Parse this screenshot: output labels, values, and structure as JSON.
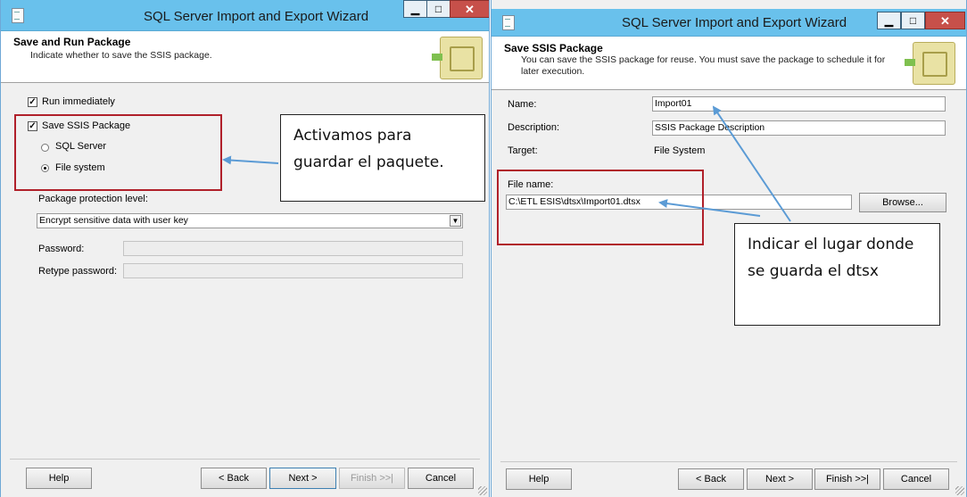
{
  "window1": {
    "title": "SQL Server Import and Export Wizard",
    "header_title": "Save and Run Package",
    "header_subtitle": "Indicate whether to save the SSIS package.",
    "run_immediately": {
      "label": "Run immediately",
      "checked": true
    },
    "save_ssis": {
      "label": "Save SSIS Package",
      "checked": true
    },
    "sql_server": {
      "label": "SQL Server",
      "selected": false
    },
    "file_system": {
      "label": "File system",
      "selected": true
    },
    "protection_label": "Package protection level:",
    "protection_value": "Encrypt sensitive data with user key",
    "password_label": "Password:",
    "retype_label": "Retype password:",
    "buttons": {
      "help": "Help",
      "back": "< Back",
      "next": "Next >",
      "finish": "Finish >>|",
      "cancel": "Cancel"
    }
  },
  "window2": {
    "title": "SQL Server Import and Export Wizard",
    "header_title": "Save SSIS Package",
    "header_subtitle": "You can save the SSIS package for reuse. You must save the package to schedule it for later execution.",
    "name_label": "Name:",
    "name_value": "Import01",
    "description_label": "Description:",
    "description_value": "SSIS Package Description",
    "target_label": "Target:",
    "target_value": "File System",
    "filename_label": "File name:",
    "filename_value": "C:\\ETL ESIS\\dtsx\\Import01.dtsx",
    "browse": "Browse...",
    "buttons": {
      "help": "Help",
      "back": "< Back",
      "next": "Next >",
      "finish": "Finish >>|",
      "cancel": "Cancel"
    }
  },
  "annotations": {
    "callout1": "Activamos para guardar el paquete.",
    "callout2": "Indicar el lugar donde se guarda el dtsx"
  },
  "colors": {
    "titlebar": "#69c1ec",
    "highlight_box": "#b0202a",
    "arrow": "#5b9bd5"
  }
}
